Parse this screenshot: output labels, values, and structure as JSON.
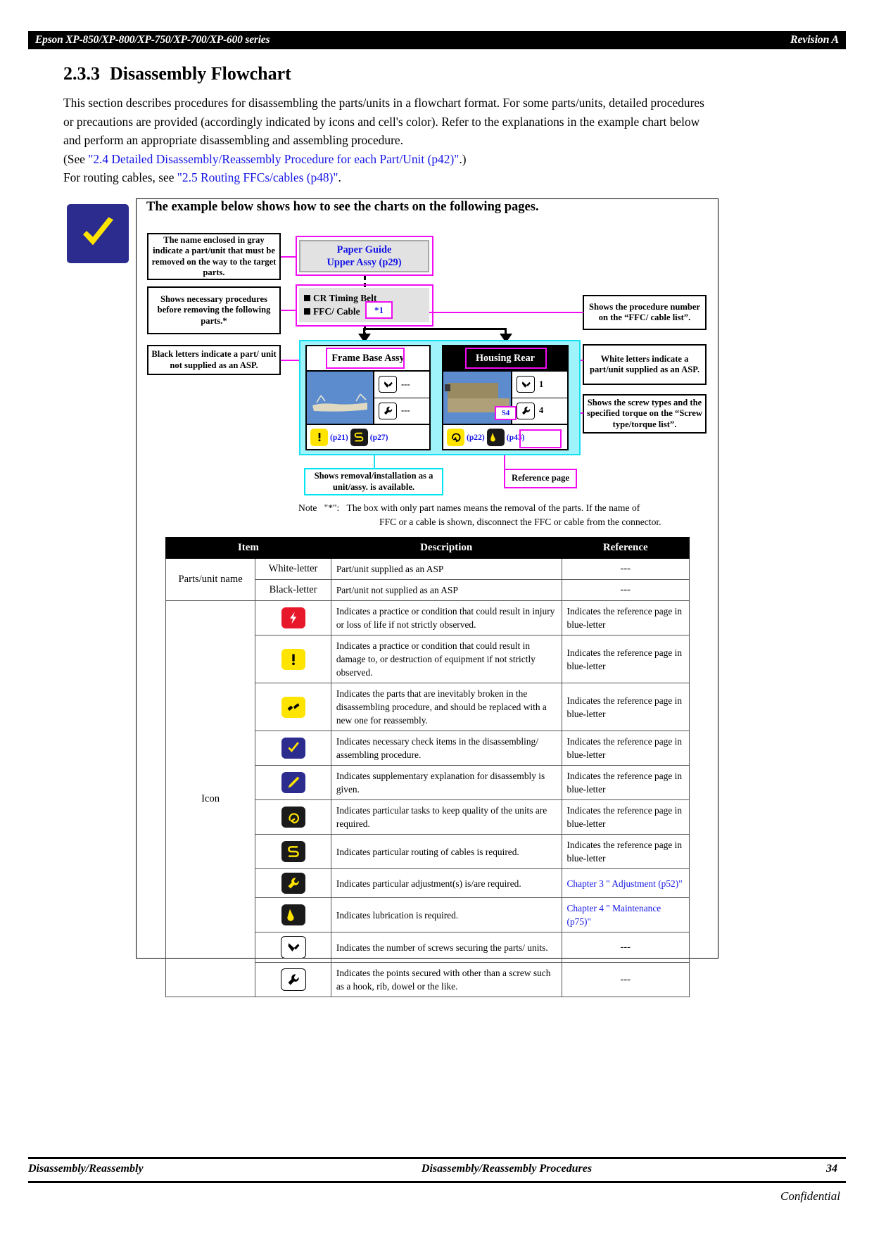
{
  "header": {
    "left": "Epson XP-850/XP-800/XP-750/XP-700/XP-600 series",
    "right": "Revision A"
  },
  "section": {
    "number": "2.3.3",
    "title": "Disassembly Flowchart",
    "para1": "This section describes procedures for disassembling the parts/units in a flowchart format. For some parts/units, detailed procedures or precautions are provided (accordingly indicated by icons and cell's color). Refer to the explanations in the example chart below and perform an appropriate disassembling and assembling procedure.",
    "see_prefix": "(See ",
    "see_link": "\"2.4 Detailed Disassembly/Reassembly Procedure for each Part/Unit (p42)\"",
    "see_suffix": ".)",
    "routing_prefix": "For routing cables, see ",
    "routing_link": "\"2.5 Routing FFCs/cables (p48)\"",
    "routing_suffix": "."
  },
  "example": {
    "title": "The example below shows how to see the charts on the following pages.",
    "callouts": {
      "gray_name": "The name enclosed in gray indicate a part/unit that must be removed on the way to the target parts.",
      "necessary": "Shows necessary procedures before removing the following parts.*",
      "black_letters": "Black letters indicate a part/ unit not supplied as an ASP.",
      "proc_number": "Shows the procedure number on the “FFC/ cable list”.",
      "white_letters": "White letters indicate a part/unit supplied as an ASP.",
      "screw_types": "Shows the screw types and the specified torque on the “Screw type/torque list”.",
      "removal_unit": "Shows removal/installation as a unit/assy. is available.",
      "reference_page": "Reference page"
    },
    "flow": {
      "paper_guide_line1": "Paper Guide",
      "paper_guide_line2": "Upper Assy (p29)",
      "ffc_item1": "CR Timing Belt",
      "ffc_item2": "FFC/ Cable",
      "star_note": "*1",
      "frame_card": {
        "title": "Frame Base Assy",
        "rows": [
          {
            "icon": "screw-icon",
            "qty": "---"
          },
          {
            "icon": "wrench-icon",
            "qty": "---"
          }
        ],
        "footer": [
          {
            "icon": "caution-icon",
            "page": "(p21)"
          },
          {
            "icon": "routing-icon",
            "page": "(p27)"
          }
        ]
      },
      "housing_card": {
        "title": "Housing Rear",
        "screw_code": "S4",
        "rows": [
          {
            "icon": "screw-icon",
            "qty": "1"
          },
          {
            "icon": "wrench-icon",
            "qty": "4"
          }
        ],
        "footer": [
          {
            "icon": "quality-icon",
            "page": "(p22)"
          },
          {
            "icon": "lubrication-icon",
            "page": "(p43)"
          }
        ]
      }
    },
    "note": {
      "label": "Note",
      "star": "\"*\":",
      "line1": "The box with only part names means the removal of the parts. If the name of",
      "line2": "FFC or a cable is shown, disconnect the FFC or cable from the connector."
    }
  },
  "legend_table": {
    "headers": [
      "Item",
      "Description",
      "Reference"
    ],
    "group1_label": "Parts/unit name",
    "group2_label": "Icon",
    "rows": [
      {
        "sub": "White-letter",
        "icon": null,
        "description": "Part/unit supplied as an ASP",
        "reference": "---",
        "ref_link": false
      },
      {
        "sub": "Black-letter",
        "icon": null,
        "description": "Part/unit not supplied as an ASP",
        "reference": "---",
        "ref_link": false
      },
      {
        "sub": null,
        "icon": "danger-icon",
        "description": "Indicates a practice or condition that could result in injury or loss of life if not strictly observed.",
        "reference": "Indicates the reference page in blue-letter",
        "ref_link": false
      },
      {
        "sub": null,
        "icon": "caution-icon",
        "description": "Indicates a practice or condition that could result in damage to, or destruction of equipment if not strictly observed.",
        "reference": "Indicates the reference page in blue-letter",
        "ref_link": false
      },
      {
        "sub": null,
        "icon": "broken-part-icon",
        "description": "Indicates the parts that are inevitably broken in the disassembling procedure, and should be replaced with a new one for reassembly.",
        "reference": "Indicates the reference page in blue-letter",
        "ref_link": false
      },
      {
        "sub": null,
        "icon": "check-icon",
        "description": "Indicates necessary check items in the disassembling/ assembling procedure.",
        "reference": "Indicates the reference page in blue-letter",
        "ref_link": false
      },
      {
        "sub": null,
        "icon": "pencil-icon",
        "description": "Indicates supplementary explanation for disassembly is given.",
        "reference": "Indicates the reference page in blue-letter",
        "ref_link": false
      },
      {
        "sub": null,
        "icon": "quality-icon",
        "description": "Indicates particular tasks to keep quality of the units are required.",
        "reference": "Indicates the reference page in blue-letter",
        "ref_link": false
      },
      {
        "sub": null,
        "icon": "routing-icon",
        "description": "Indicates particular routing of cables is required.",
        "reference": "Indicates the reference page in blue-letter",
        "ref_link": false
      },
      {
        "sub": null,
        "icon": "adjustment-icon",
        "description": "Indicates particular adjustment(s) is/are required.",
        "reference": "Chapter 3 \" Adjustment (p52)\"",
        "ref_link": true
      },
      {
        "sub": null,
        "icon": "lubrication-icon",
        "description": "Indicates lubrication is required.",
        "reference": "Chapter 4 \" Maintenance (p75)\"",
        "ref_link": true
      },
      {
        "sub": null,
        "icon": "screw-icon",
        "description": "Indicates the number of screws securing the parts/ units.",
        "reference": "---",
        "ref_link": false
      },
      {
        "sub": null,
        "icon": "wrench-icon",
        "description": "Indicates the points secured with other than a screw such as a hook, rib, dowel or the like.",
        "reference": "---",
        "ref_link": false
      }
    ]
  },
  "footer": {
    "left": "Disassembly/Reassembly",
    "center": "Disassembly/Reassembly Procedures",
    "page": "34",
    "confidential": "Confidential"
  },
  "colors": {
    "link_blue": "#1414e6",
    "magenta": "#f20bf2",
    "cyan": "#17e0f2",
    "gray_fill": "#e2e2e2",
    "badge_blue": "#2c2c8f",
    "icon_yellow": "#ffe400",
    "icon_red": "#e8182b"
  }
}
